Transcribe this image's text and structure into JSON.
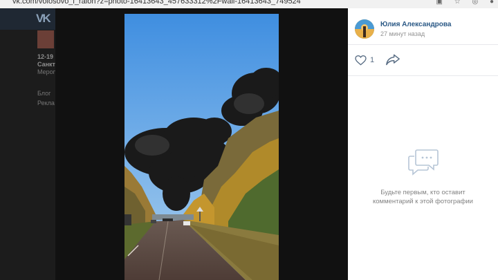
{
  "browser": {
    "url": "vk.com/volosovo_i_raion?z=photo-16413643_457633312%2Fwall-16413643_749524"
  },
  "background_page": {
    "lines": [
      {
        "text": "12-19",
        "bold": true
      },
      {
        "text": "Санкт",
        "bold": true
      },
      {
        "text": "Мероп",
        "bold": false
      },
      {
        "text": "Блог",
        "bold": false
      },
      {
        "text": "Рекла",
        "bold": false
      }
    ]
  },
  "photo": {
    "description_icon": "photo-smoke-fire"
  },
  "panel": {
    "author_name": "Юлия Александрова",
    "post_time": "27 минут назад",
    "likes_count": "1",
    "empty_comments_line1": "Будьте первым, кто оставит",
    "empty_comments_line2": "комментарий к этой фотографии"
  },
  "colors": {
    "link": "#2a5885",
    "muted": "#939393",
    "icon": "#5a6e85"
  }
}
